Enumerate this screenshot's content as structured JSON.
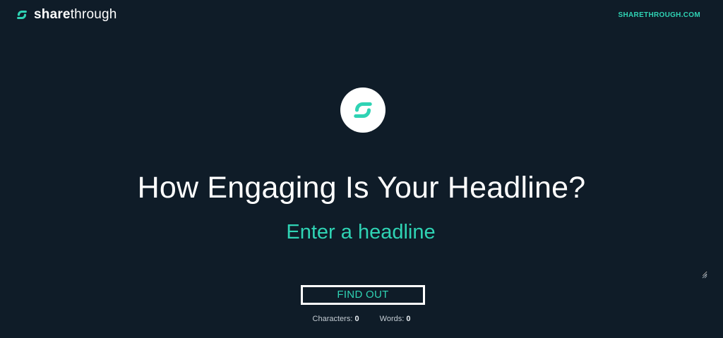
{
  "header": {
    "brand_bold": "share",
    "brand_light": "through",
    "site_link": "SHARETHROUGH.COM"
  },
  "main": {
    "title": "How Engaging Is Your Headline?",
    "headline_placeholder": "Enter a headline",
    "headline_value": "",
    "button_label": "FIND OUT"
  },
  "stats": {
    "characters_label": "Characters:",
    "characters_value": "0",
    "words_label": "Words:",
    "words_value": "0"
  },
  "colors": {
    "background": "#0f1c28",
    "accent": "#2fd3b4",
    "text": "#ffffff"
  },
  "icons": {
    "brand": "sharethrough-logo-icon",
    "center": "sharethrough-logo-icon",
    "grip": "resize-grip-icon"
  }
}
